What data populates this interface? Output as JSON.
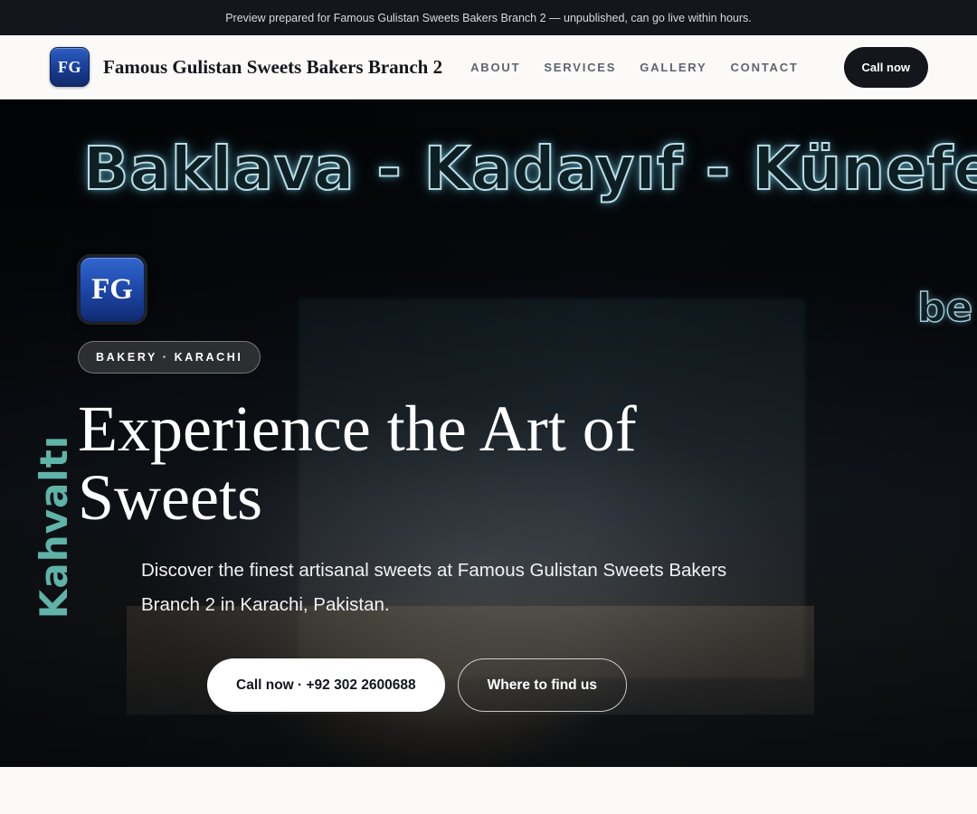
{
  "preview_banner": "Preview prepared for Famous Gulistan Sweets Bakers Branch 2 — unpublished, can go live within hours.",
  "brand": {
    "initials": "FG",
    "name": "Famous Gulistan Sweets Bakers Branch 2",
    "badge_color": "#1b45a3"
  },
  "nav": {
    "links": [
      "ABOUT",
      "SERVICES",
      "GALLERY",
      "CONTACT"
    ],
    "cta_label": "Call now"
  },
  "hero": {
    "signage": {
      "main": "Baklava - Kadayıf - Künefe",
      "side": "Kahvaltı",
      "right": "be"
    },
    "badge_initials": "FG",
    "tag": "BAKERY · KARACHI",
    "title": "Experience the Art of Sweets",
    "subtitle": "Discover the finest artisanal sweets at Famous Gulistan Sweets Bakers Branch 2 in Karachi, Pakistan.",
    "primary_cta": "Call now · +92 302 2600688",
    "secondary_cta": "Where to find us"
  }
}
